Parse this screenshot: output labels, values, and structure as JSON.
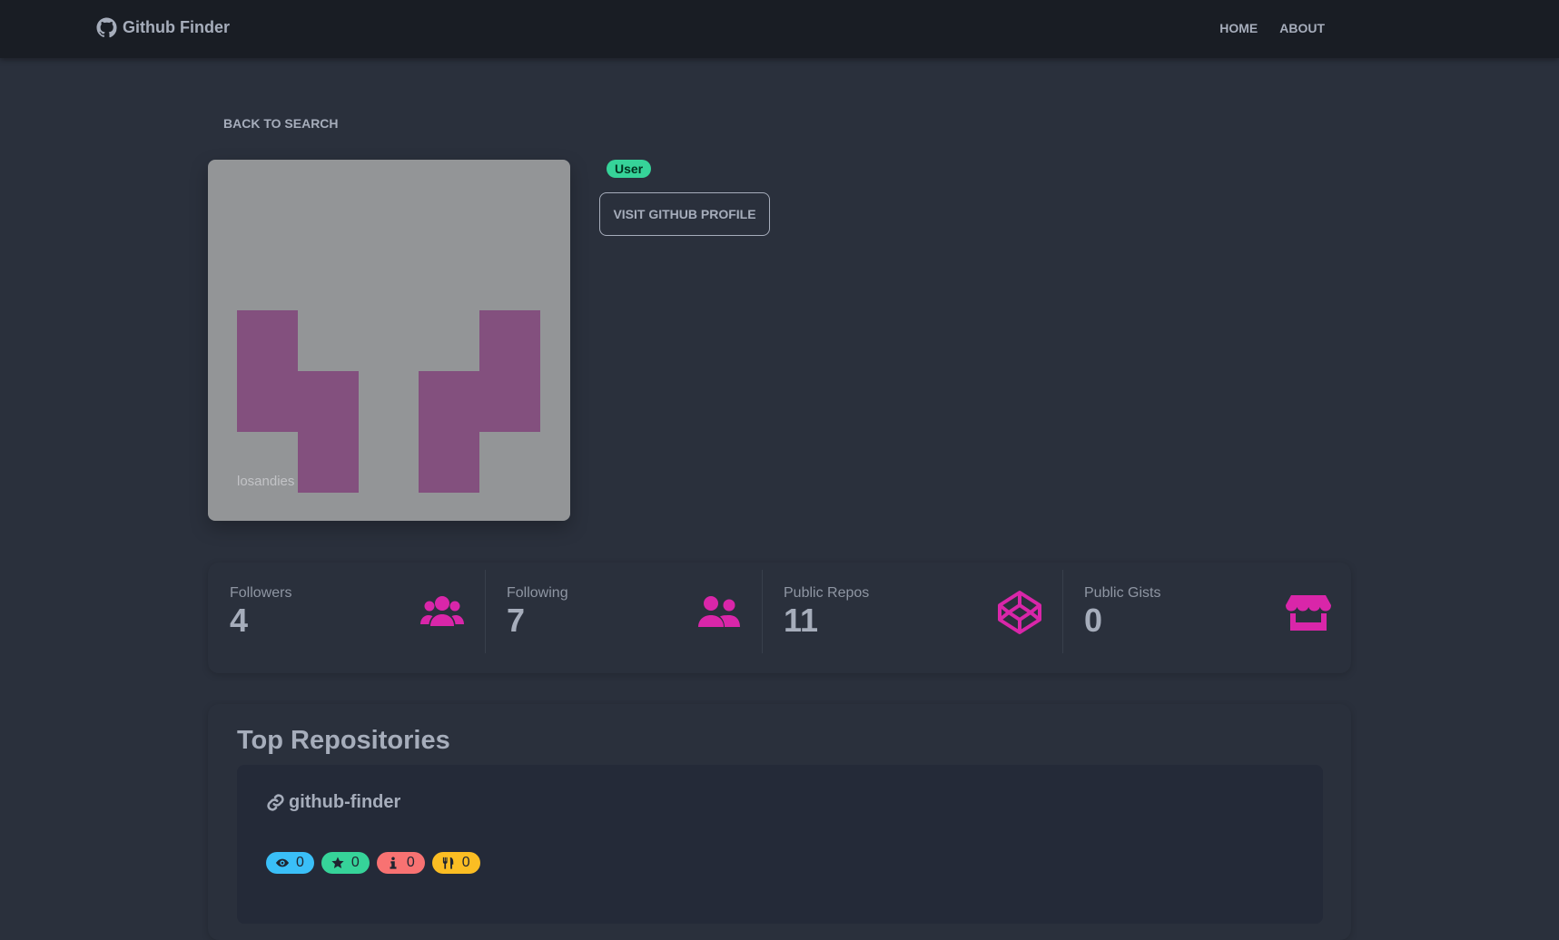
{
  "navbar": {
    "brand": "Github Finder",
    "links": [
      "HOME",
      "ABOUT"
    ]
  },
  "profile": {
    "back_label": "Back to search",
    "avatar_caption": "losandies",
    "type_badge": "User",
    "visit_label": "VISIT GITHUB PROFILE"
  },
  "stats": [
    {
      "title": "Followers",
      "value": "4",
      "icon": "users-icon"
    },
    {
      "title": "Following",
      "value": "7",
      "icon": "user-friends-icon"
    },
    {
      "title": "Public Repos",
      "value": "11",
      "icon": "codepen-icon"
    },
    {
      "title": "Public Gists",
      "value": "0",
      "icon": "store-icon"
    }
  ],
  "repos": {
    "heading": "Top Repositories",
    "items": [
      {
        "name": "github-finder",
        "watchers": "0",
        "stars": "0",
        "issues": "0",
        "forks": "0"
      }
    ]
  },
  "colors": {
    "accent": "#d926a9",
    "success": "#36d399",
    "info": "#3abff8",
    "error": "#f87272",
    "warning": "#fbbd23",
    "identicon": "#83507e"
  }
}
